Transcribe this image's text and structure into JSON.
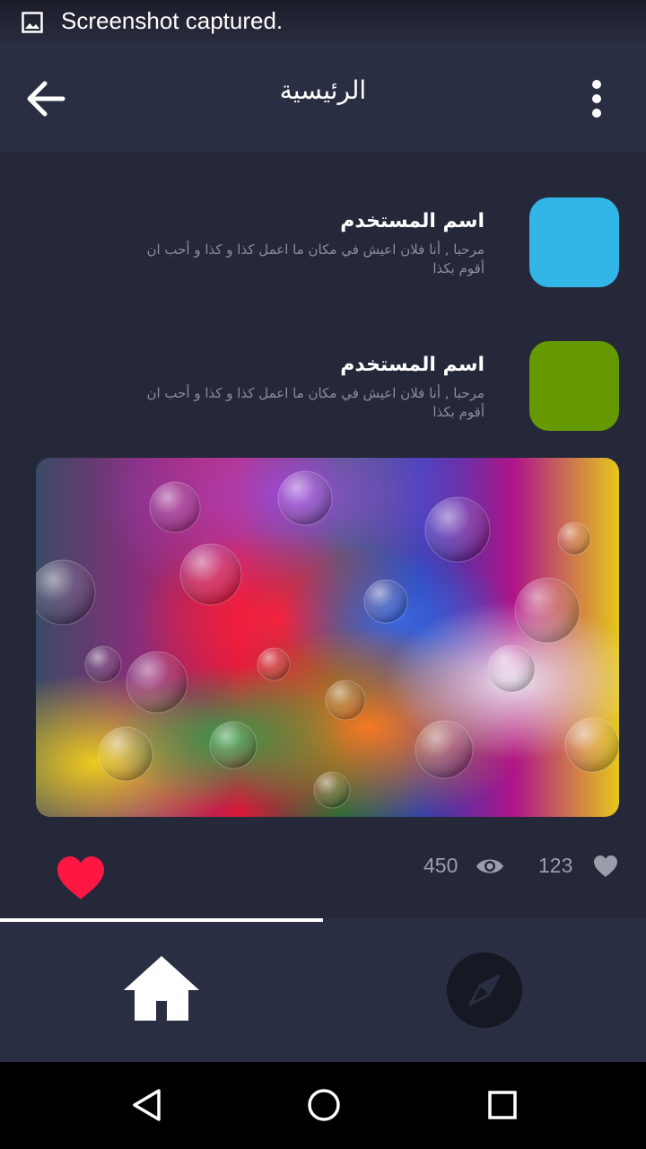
{
  "status_bar": {
    "notification": "Screenshot captured.",
    "icon": "image-icon"
  },
  "app_bar": {
    "title": "الرئيسية",
    "back_icon": "arrow-back-icon",
    "menu_icon": "more-vert-icon"
  },
  "posts": [
    {
      "username": "اسم المستخدم",
      "text": "مرحبا , أنا فلان اعيش في مكان ما اعمل كذا و كذا و أحب ان أقوم بكذا",
      "avatar_color": "#31b6e7"
    },
    {
      "username": "اسم المستخدم",
      "text": "مرحبا , أنا فلان اعيش في مكان ما اعمل كذا و كذا و أحب ان أقوم بكذا",
      "avatar_color": "#669900"
    }
  ],
  "media_post": {
    "image": "colorful-bubbles-image",
    "views": "450",
    "likes": "123",
    "like_icon": "heart-icon",
    "like_color": "#ff1744"
  },
  "tabs": [
    {
      "name": "home",
      "icon": "home-icon",
      "active": true
    },
    {
      "name": "explore",
      "icon": "compass-icon",
      "active": false
    }
  ],
  "nav_bar": {
    "back": "back-triangle-icon",
    "home": "home-circle-icon",
    "recents": "recents-square-icon"
  },
  "colors": {
    "background": "#252839",
    "app_bar": "#2a2e42",
    "accent": "#ff1744"
  }
}
